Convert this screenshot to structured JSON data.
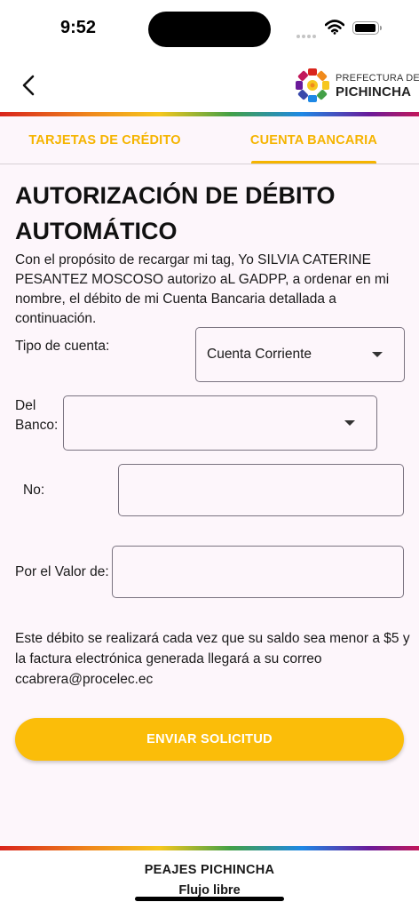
{
  "status_bar": {
    "time": "9:52",
    "icons": [
      "cellular-signal-icon",
      "wifi-icon",
      "battery-icon"
    ]
  },
  "header": {
    "back_icon": "chevron-left-icon",
    "logo_line1": "PREFECTURA DE",
    "logo_line2": "PICHINCHA"
  },
  "tabs": [
    {
      "label": "TARJETAS DE CRÉDITO",
      "active": false
    },
    {
      "label": "CUENTA BANCARIA",
      "active": true
    }
  ],
  "form": {
    "title": "AUTORIZACIÓN DE DÉBITO AUTOMÁTICO",
    "intro": "Con el propósito de recargar mi tag, Yo SILVIA CATERINE PESANTEZ MOSCOSO autorizo aL GADPP, a ordenar en mi nombre, el débito de mi Cuenta Bancaria detallada a continuación.",
    "account_type_label": "Tipo de cuenta:",
    "account_type_value": "Cuenta Corriente",
    "bank_label_line1": "Del",
    "bank_label_line2": "Banco:",
    "bank_value": "",
    "number_label": "No:",
    "number_value": "",
    "amount_label": "Por el Valor de:",
    "amount_value": "",
    "note": "Este débito se realizará cada vez que su saldo sea menor a $5 y la factura electrónica generada llegará a su correo ccabrera@procelec.ec",
    "submit_label": "ENVIAR SOLICITUD"
  },
  "footer": {
    "line1": "PEAJES PICHINCHA",
    "line2": "Flujo libre"
  },
  "colors": {
    "accent": "#F5B400",
    "button": "#FBBD09",
    "background": "#FDF6FB",
    "field_border": "#7A7380"
  }
}
